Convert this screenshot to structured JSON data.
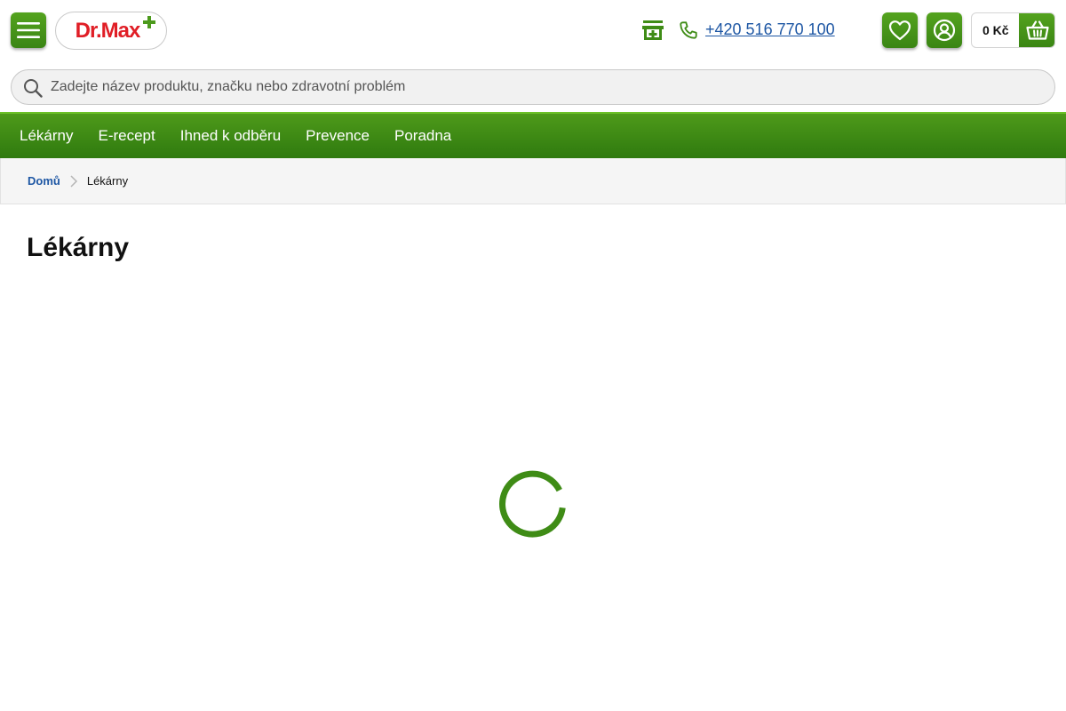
{
  "header": {
    "logo_text": "Dr.Max",
    "phone": "+420 516 770 100",
    "cart_amount": "0 Kč",
    "icons": {
      "menu": "hamburger-menu-icon",
      "store": "pharmacy-store-icon",
      "phone": "phone-icon",
      "favorites": "heart-icon",
      "account": "user-account-icon",
      "cart": "shopping-basket-icon"
    }
  },
  "search": {
    "placeholder": "Zadejte název produktu, značku nebo zdravotní problém",
    "icon": "search-icon"
  },
  "nav": {
    "items": [
      "Lékárny",
      "E-recept",
      "Ihned k odběru",
      "Prevence",
      "Poradna"
    ]
  },
  "breadcrumb": {
    "home": "Domů",
    "current": "Lékárny"
  },
  "main": {
    "title": "Lékárny",
    "loading_icon": "loading-spinner-icon"
  },
  "colors": {
    "brand_green": "#3f8c16",
    "brand_red": "#e01e26",
    "link_blue": "#1e57a4"
  }
}
